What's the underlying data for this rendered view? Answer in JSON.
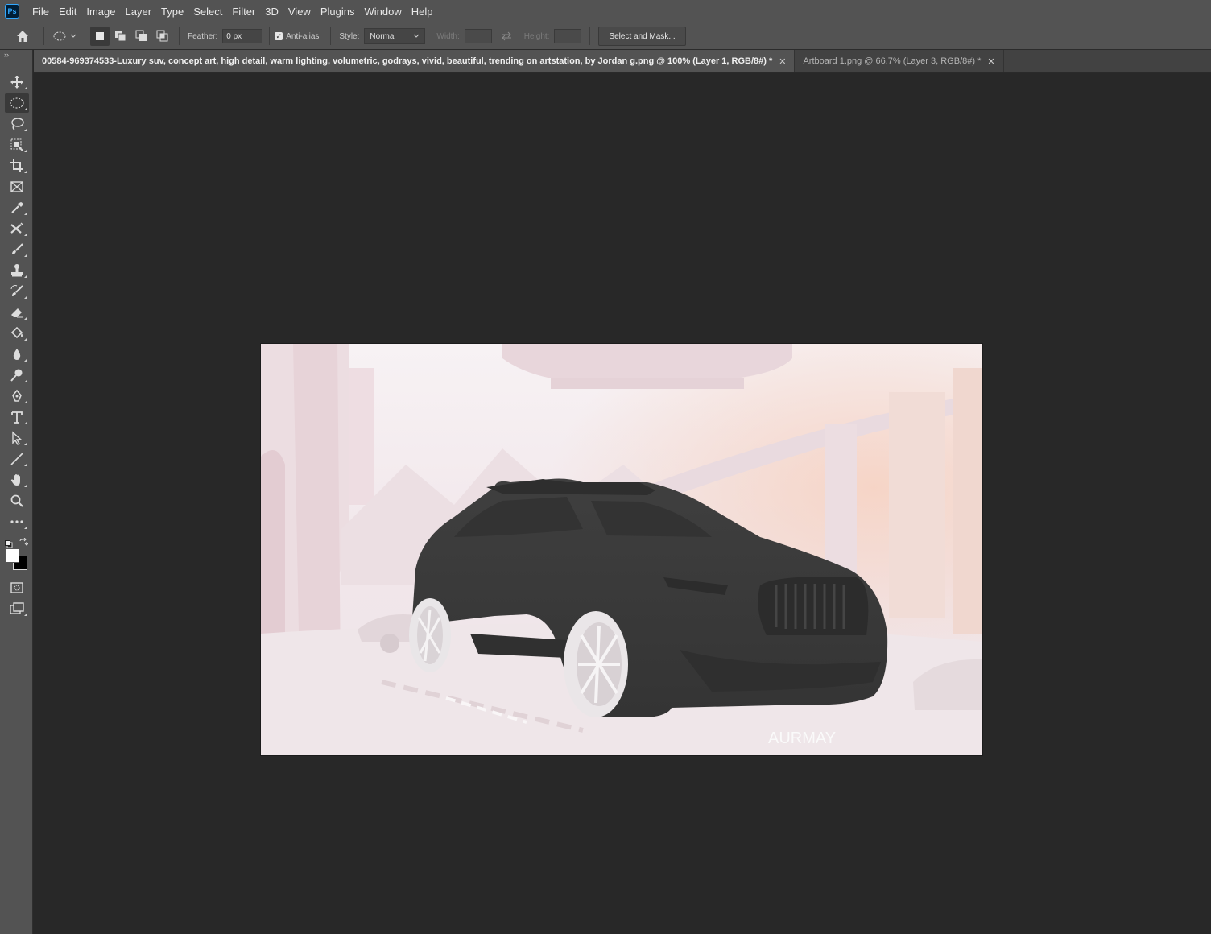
{
  "app": {
    "logo_text": "Ps"
  },
  "menu": [
    "File",
    "Edit",
    "Image",
    "Layer",
    "Type",
    "Select",
    "Filter",
    "3D",
    "View",
    "Plugins",
    "Window",
    "Help"
  ],
  "options": {
    "feather_label": "Feather:",
    "feather_value": "0 px",
    "antialias_label": "Anti-alias",
    "antialias_checked": true,
    "style_label": "Style:",
    "style_value": "Normal",
    "width_label": "Width:",
    "height_label": "Height:",
    "select_mask_label": "Select and Mask..."
  },
  "toolbar": {
    "collapse": "››",
    "tools": [
      "move-tool-icon",
      "elliptical-marquee-tool-icon",
      "lasso-tool-icon",
      "object-selection-tool-icon",
      "crop-tool-icon",
      "frame-tool-icon",
      "eyedropper-tool-icon",
      "healing-brush-tool-icon",
      "brush-tool-icon",
      "clone-stamp-tool-icon",
      "history-brush-tool-icon",
      "eraser-tool-icon",
      "paint-bucket-tool-icon",
      "blur-tool-icon",
      "dodge-tool-icon",
      "pen-tool-icon",
      "type-tool-icon",
      "path-selection-tool-icon",
      "line-tool-icon",
      "hand-tool-icon",
      "zoom-tool-icon",
      "edit-toolbar-icon"
    ],
    "foreground_color": "#ffffff",
    "background_color": "#000000"
  },
  "tabs": [
    {
      "label": "00584-969374533-Luxury  suv, concept art, high detail, warm lighting, volumetric, godrays, vivid, beautiful, trending on artstation, by Jordan g.png @ 100% (Layer 1, RGB/8#) *",
      "active": true
    },
    {
      "label": "Artboard 1.png @ 66.7% (Layer 3, RGB/8#) *",
      "active": false
    }
  ],
  "document": {
    "signature": "AURMAY",
    "colors": {
      "sky": "#f6eff1",
      "haze": "#ecdfe3",
      "suv": "#3b3b3b",
      "wheel": "#e9e6e8",
      "warm": "#f4c9b8"
    }
  }
}
